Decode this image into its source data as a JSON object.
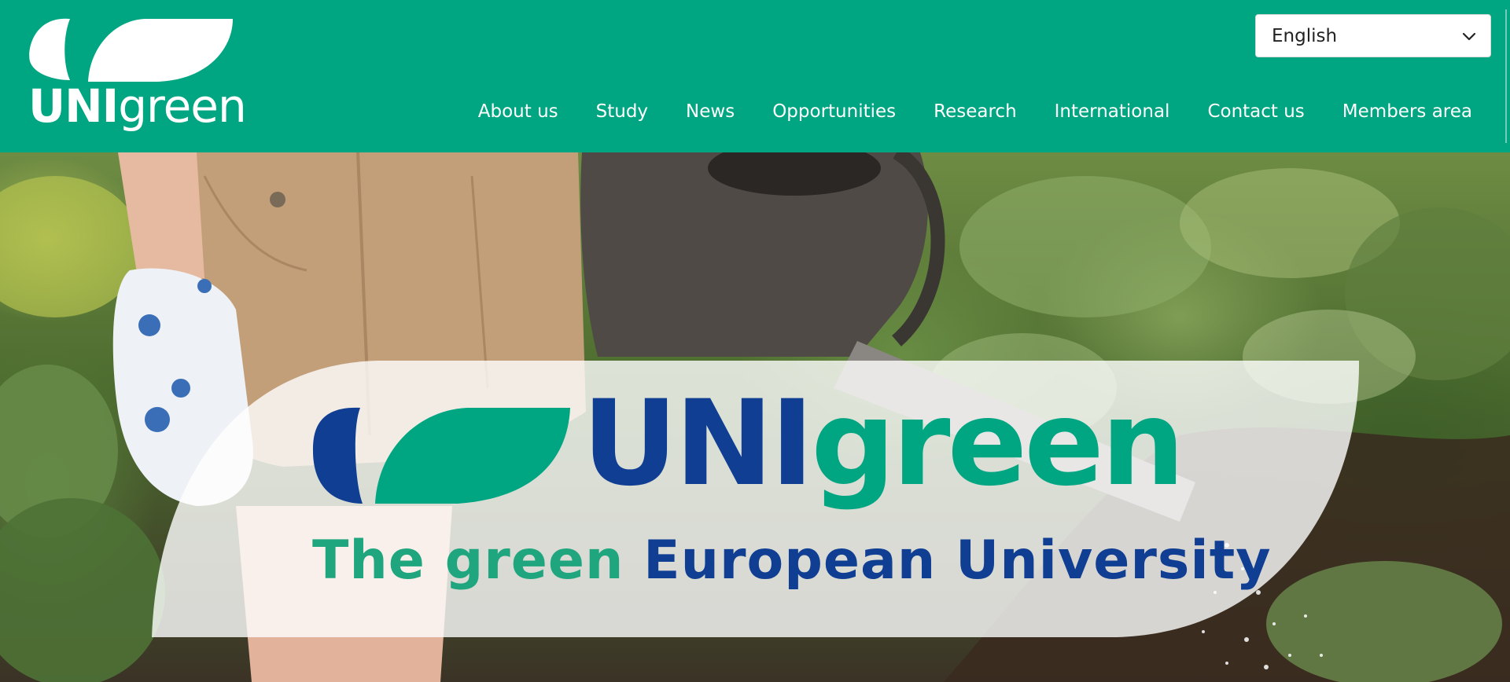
{
  "header": {
    "logo_text_uni": "UNI",
    "logo_text_green": "green",
    "language": {
      "selected": "English"
    },
    "nav": [
      {
        "label": "About us"
      },
      {
        "label": "Study"
      },
      {
        "label": "News"
      },
      {
        "label": "Opportunities"
      },
      {
        "label": "Research"
      },
      {
        "label": "International"
      },
      {
        "label": "Contact us"
      },
      {
        "label": "Members area"
      }
    ]
  },
  "hero": {
    "title_uni": "UNI",
    "title_green": "green",
    "tagline_part1": "The green",
    "tagline_part2": "European University"
  },
  "colors": {
    "brand_green": "#00a582",
    "brand_blue": "#0f3e93",
    "white": "#ffffff"
  },
  "icons": {
    "language_dropdown": "chevron-down-icon",
    "logo_leaves": "leaf-icon"
  }
}
